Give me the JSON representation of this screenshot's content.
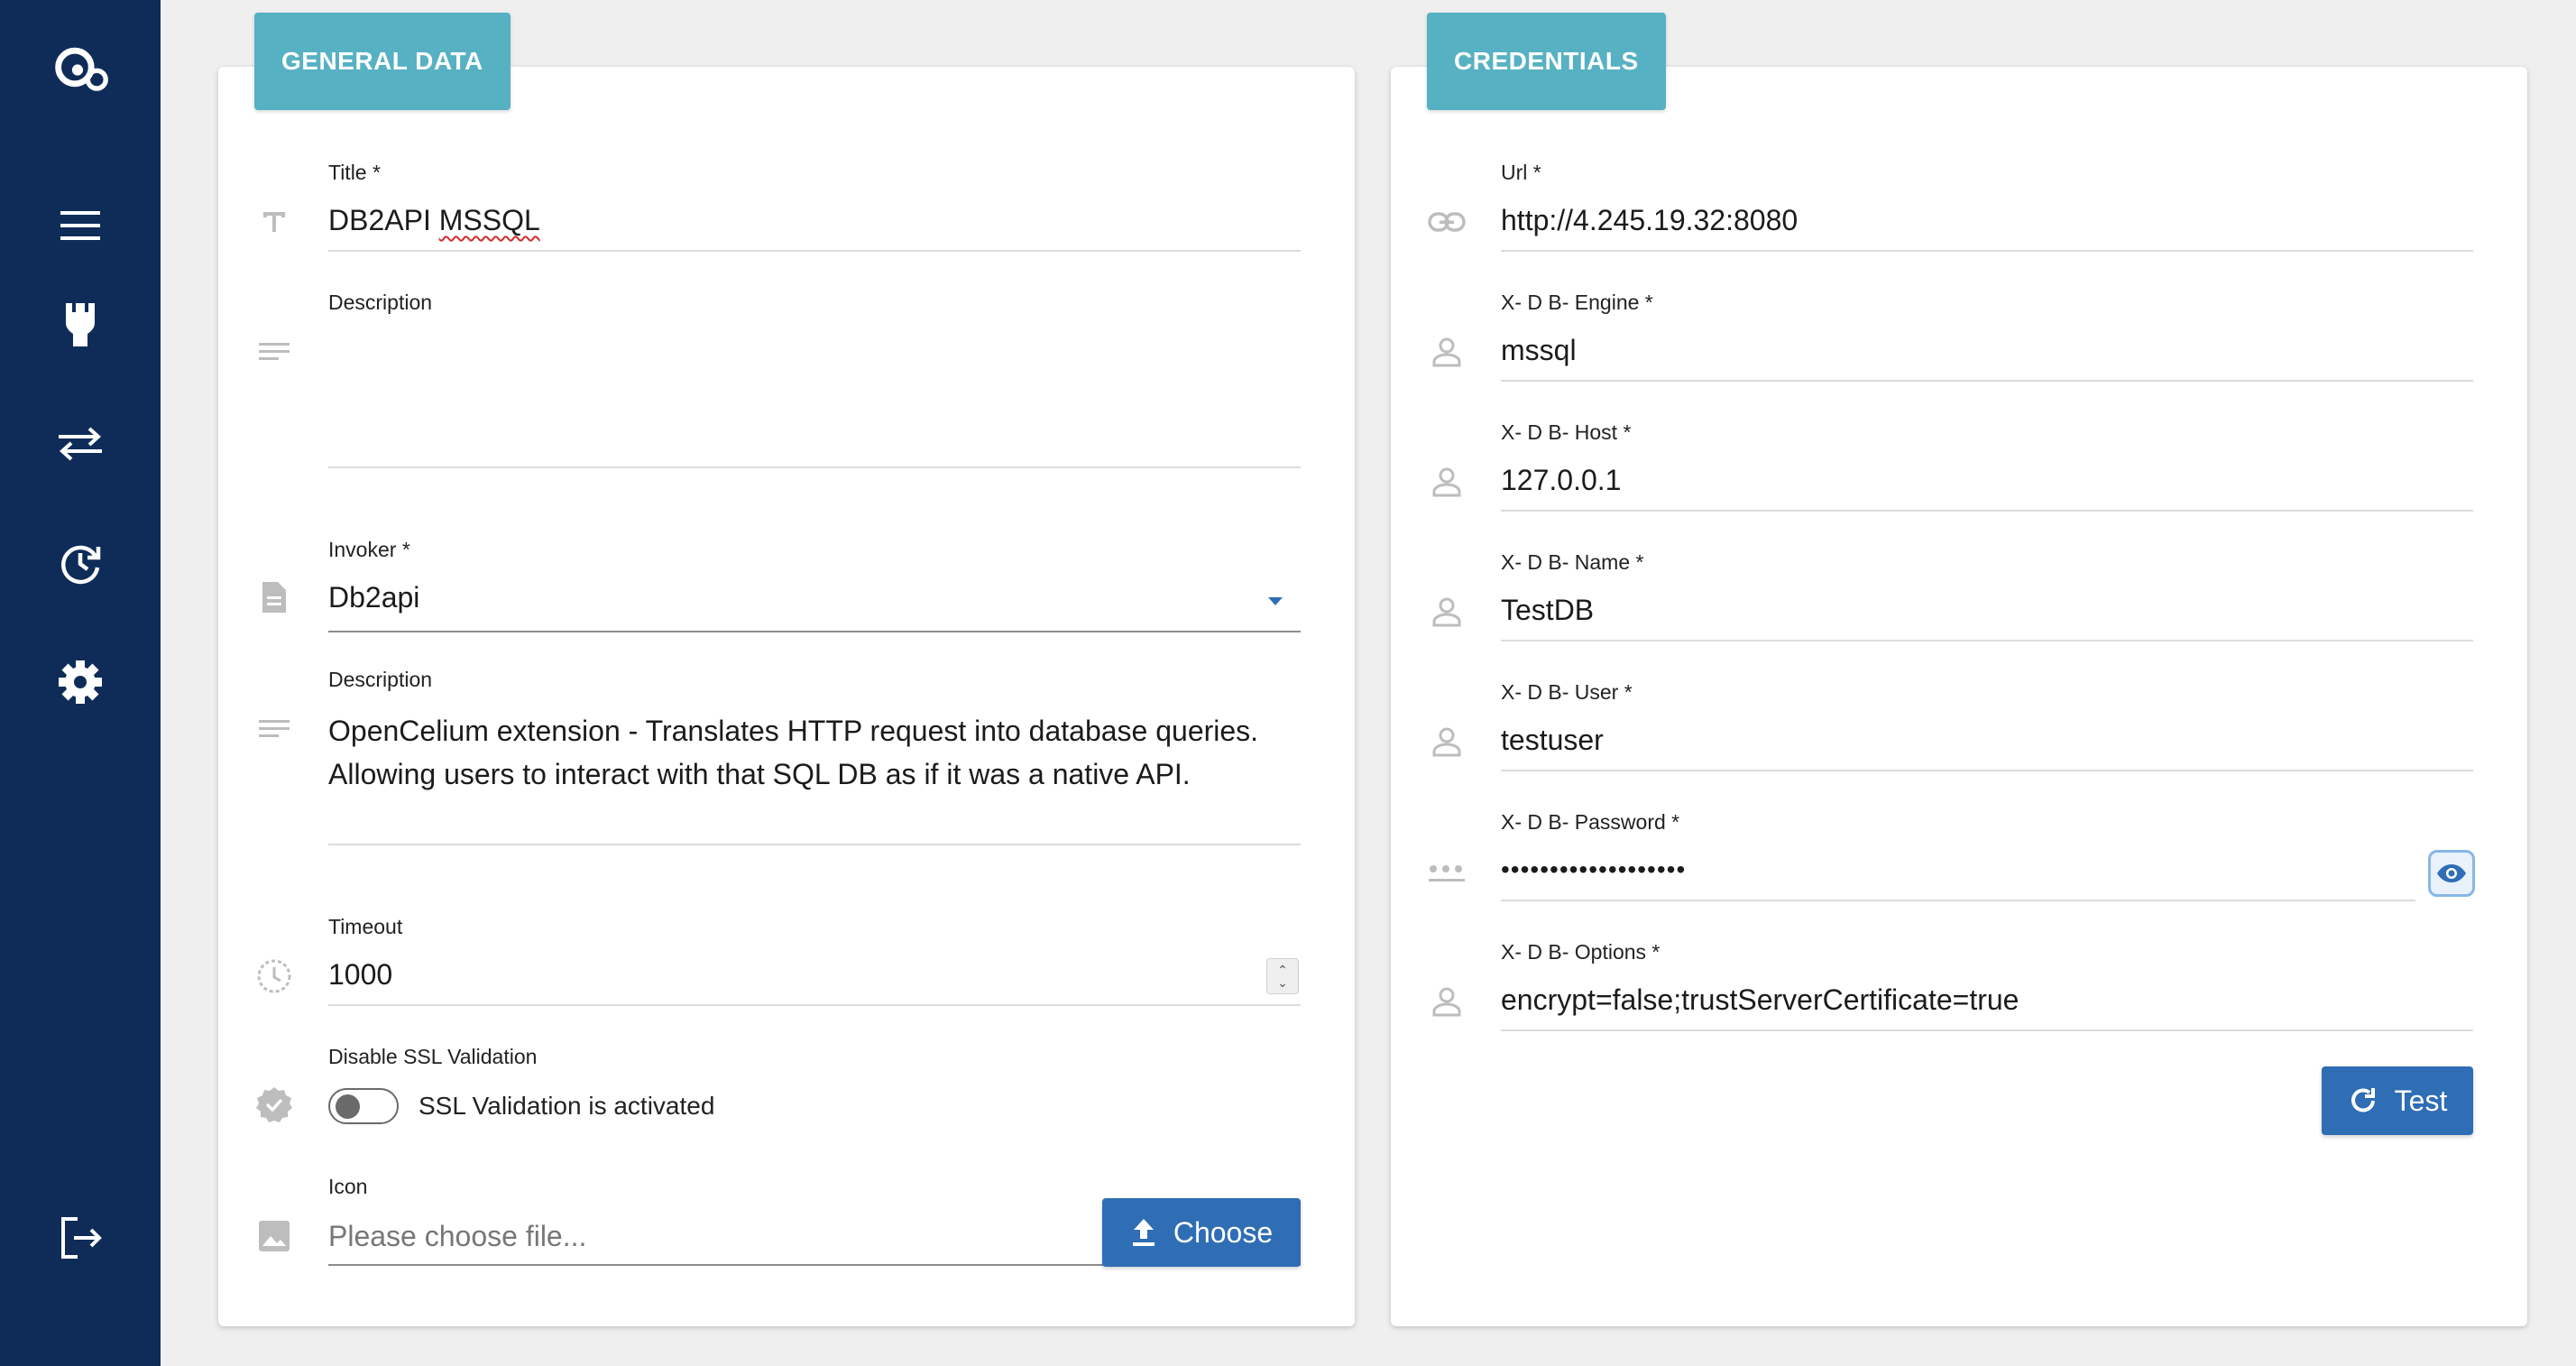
{
  "sidebar": {
    "items": [
      {
        "name": "logo-icon"
      },
      {
        "name": "menu-icon"
      },
      {
        "name": "connector-icon"
      },
      {
        "name": "transfer-icon"
      },
      {
        "name": "history-icon"
      },
      {
        "name": "settings-icon"
      },
      {
        "name": "logout-icon"
      }
    ]
  },
  "general": {
    "tab_label": "GENERAL DATA",
    "title_label": "Title *",
    "title_value": "DB2API MSSQL",
    "title_value_a": "DB2API ",
    "title_value_b": "MSSQL",
    "description_label": "Description",
    "description_value": "",
    "invoker_label": "Invoker *",
    "invoker_value": "Db2api",
    "invoker_description_label": "Description",
    "invoker_description_value": "OpenCelium extension - Translates HTTP request into database queries. Allowing users to interact with that SQL DB as if it was a native API.",
    "timeout_label": "Timeout",
    "timeout_value": "1000",
    "ssl_label": "Disable SSL Validation",
    "ssl_toggle_text": "SSL Validation is activated",
    "ssl_disabled": false,
    "icon_label": "Icon",
    "icon_placeholder": "Please choose file...",
    "choose_button": "Choose"
  },
  "credentials": {
    "tab_label": "CREDENTIALS",
    "url_label": "Url *",
    "url_value": "http://4.245.19.32:8080",
    "engine_label": "X- D B- Engine *",
    "engine_value": "mssql",
    "host_label": "X- D B- Host *",
    "host_value": "127.0.0.1",
    "name_label": "X- D B- Name *",
    "name_value": "TestDB",
    "user_label": "X- D B- User *",
    "user_value": "testuser",
    "password_label": "X- D B- Password *",
    "password_value": "•••••••••••••••••••",
    "options_label": "X- D B- Options *",
    "options_value": "encrypt=false;trustServerCertificate=true",
    "test_button": "Test"
  },
  "colors": {
    "sidebar": "#0f2c59",
    "tab": "#56b1c3",
    "primary_button": "#2f6db5",
    "background": "#efefef"
  }
}
